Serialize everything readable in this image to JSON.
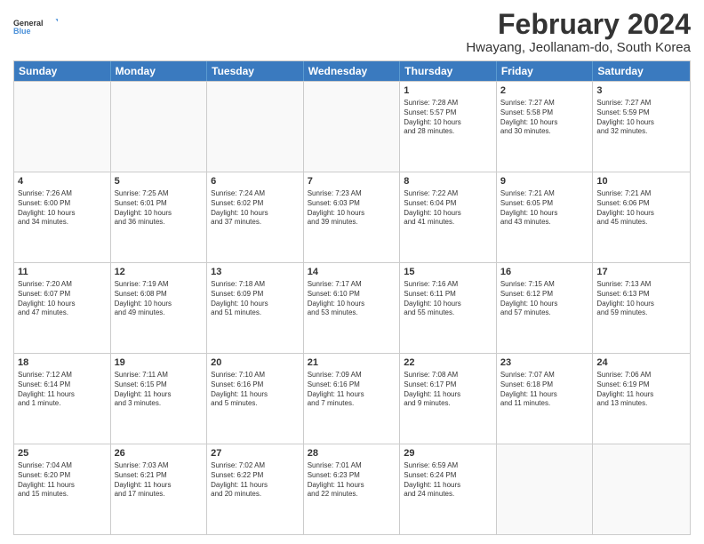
{
  "logo": {
    "line1": "General",
    "line2": "Blue"
  },
  "title": "February 2024",
  "subtitle": "Hwayang, Jeollanam-do, South Korea",
  "days": [
    "Sunday",
    "Monday",
    "Tuesday",
    "Wednesday",
    "Thursday",
    "Friday",
    "Saturday"
  ],
  "weeks": [
    [
      {
        "day": "",
        "info": ""
      },
      {
        "day": "",
        "info": ""
      },
      {
        "day": "",
        "info": ""
      },
      {
        "day": "",
        "info": ""
      },
      {
        "day": "1",
        "info": "Sunrise: 7:28 AM\nSunset: 5:57 PM\nDaylight: 10 hours\nand 28 minutes."
      },
      {
        "day": "2",
        "info": "Sunrise: 7:27 AM\nSunset: 5:58 PM\nDaylight: 10 hours\nand 30 minutes."
      },
      {
        "day": "3",
        "info": "Sunrise: 7:27 AM\nSunset: 5:59 PM\nDaylight: 10 hours\nand 32 minutes."
      }
    ],
    [
      {
        "day": "4",
        "info": "Sunrise: 7:26 AM\nSunset: 6:00 PM\nDaylight: 10 hours\nand 34 minutes."
      },
      {
        "day": "5",
        "info": "Sunrise: 7:25 AM\nSunset: 6:01 PM\nDaylight: 10 hours\nand 36 minutes."
      },
      {
        "day": "6",
        "info": "Sunrise: 7:24 AM\nSunset: 6:02 PM\nDaylight: 10 hours\nand 37 minutes."
      },
      {
        "day": "7",
        "info": "Sunrise: 7:23 AM\nSunset: 6:03 PM\nDaylight: 10 hours\nand 39 minutes."
      },
      {
        "day": "8",
        "info": "Sunrise: 7:22 AM\nSunset: 6:04 PM\nDaylight: 10 hours\nand 41 minutes."
      },
      {
        "day": "9",
        "info": "Sunrise: 7:21 AM\nSunset: 6:05 PM\nDaylight: 10 hours\nand 43 minutes."
      },
      {
        "day": "10",
        "info": "Sunrise: 7:21 AM\nSunset: 6:06 PM\nDaylight: 10 hours\nand 45 minutes."
      }
    ],
    [
      {
        "day": "11",
        "info": "Sunrise: 7:20 AM\nSunset: 6:07 PM\nDaylight: 10 hours\nand 47 minutes."
      },
      {
        "day": "12",
        "info": "Sunrise: 7:19 AM\nSunset: 6:08 PM\nDaylight: 10 hours\nand 49 minutes."
      },
      {
        "day": "13",
        "info": "Sunrise: 7:18 AM\nSunset: 6:09 PM\nDaylight: 10 hours\nand 51 minutes."
      },
      {
        "day": "14",
        "info": "Sunrise: 7:17 AM\nSunset: 6:10 PM\nDaylight: 10 hours\nand 53 minutes."
      },
      {
        "day": "15",
        "info": "Sunrise: 7:16 AM\nSunset: 6:11 PM\nDaylight: 10 hours\nand 55 minutes."
      },
      {
        "day": "16",
        "info": "Sunrise: 7:15 AM\nSunset: 6:12 PM\nDaylight: 10 hours\nand 57 minutes."
      },
      {
        "day": "17",
        "info": "Sunrise: 7:13 AM\nSunset: 6:13 PM\nDaylight: 10 hours\nand 59 minutes."
      }
    ],
    [
      {
        "day": "18",
        "info": "Sunrise: 7:12 AM\nSunset: 6:14 PM\nDaylight: 11 hours\nand 1 minute."
      },
      {
        "day": "19",
        "info": "Sunrise: 7:11 AM\nSunset: 6:15 PM\nDaylight: 11 hours\nand 3 minutes."
      },
      {
        "day": "20",
        "info": "Sunrise: 7:10 AM\nSunset: 6:16 PM\nDaylight: 11 hours\nand 5 minutes."
      },
      {
        "day": "21",
        "info": "Sunrise: 7:09 AM\nSunset: 6:16 PM\nDaylight: 11 hours\nand 7 minutes."
      },
      {
        "day": "22",
        "info": "Sunrise: 7:08 AM\nSunset: 6:17 PM\nDaylight: 11 hours\nand 9 minutes."
      },
      {
        "day": "23",
        "info": "Sunrise: 7:07 AM\nSunset: 6:18 PM\nDaylight: 11 hours\nand 11 minutes."
      },
      {
        "day": "24",
        "info": "Sunrise: 7:06 AM\nSunset: 6:19 PM\nDaylight: 11 hours\nand 13 minutes."
      }
    ],
    [
      {
        "day": "25",
        "info": "Sunrise: 7:04 AM\nSunset: 6:20 PM\nDaylight: 11 hours\nand 15 minutes."
      },
      {
        "day": "26",
        "info": "Sunrise: 7:03 AM\nSunset: 6:21 PM\nDaylight: 11 hours\nand 17 minutes."
      },
      {
        "day": "27",
        "info": "Sunrise: 7:02 AM\nSunset: 6:22 PM\nDaylight: 11 hours\nand 20 minutes."
      },
      {
        "day": "28",
        "info": "Sunrise: 7:01 AM\nSunset: 6:23 PM\nDaylight: 11 hours\nand 22 minutes."
      },
      {
        "day": "29",
        "info": "Sunrise: 6:59 AM\nSunset: 6:24 PM\nDaylight: 11 hours\nand 24 minutes."
      },
      {
        "day": "",
        "info": ""
      },
      {
        "day": "",
        "info": ""
      }
    ]
  ]
}
